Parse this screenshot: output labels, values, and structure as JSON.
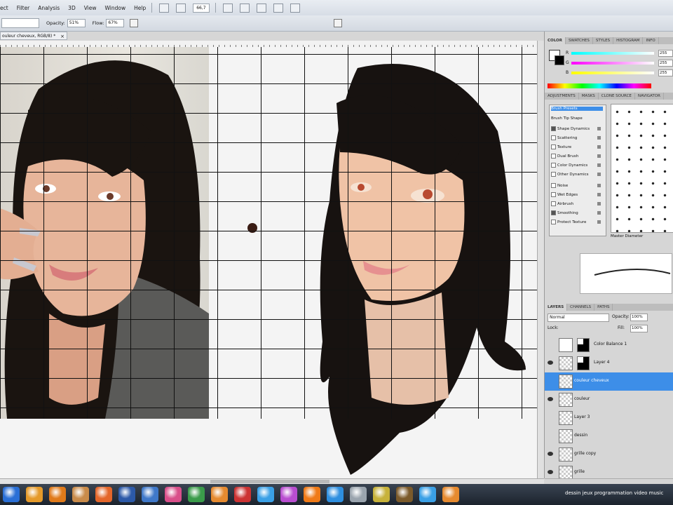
{
  "menubar": {
    "items": [
      "ect",
      "Filter",
      "Analysis",
      "3D",
      "View",
      "Window",
      "Help"
    ],
    "zoom": "66,7"
  },
  "options": {
    "opacity_label": "Opacity:",
    "opacity_value": "51%",
    "flow_label": "Flow:",
    "flow_value": "67%"
  },
  "document": {
    "tab_title": "ouleur cheveux, RGB/8) *",
    "close": "×"
  },
  "color_panel": {
    "tabs": [
      "COLOR",
      "SWATCHES",
      "STYLES",
      "HISTOGRAM",
      "INFO"
    ],
    "channels": [
      {
        "label": "R",
        "value": "255"
      },
      {
        "label": "G",
        "value": "255"
      },
      {
        "label": "B",
        "value": "255"
      }
    ]
  },
  "brush_panel": {
    "tabs": [
      "ADJUSTMENTS",
      "MASKS",
      "CLONE SOURCE",
      "NAVIGATOR"
    ],
    "items": [
      {
        "label": "Brush Presets",
        "checkbox": false,
        "selected": true
      },
      {
        "label": "Brush Tip Shape",
        "checkbox": false,
        "selected": false
      },
      {
        "label": "Shape Dynamics",
        "checkbox": true,
        "checked": true
      },
      {
        "label": "Scattering",
        "checkbox": true,
        "checked": false
      },
      {
        "label": "Texture",
        "checkbox": true,
        "checked": false
      },
      {
        "label": "Dual Brush",
        "checkbox": true,
        "checked": false
      },
      {
        "label": "Color Dynamics",
        "checkbox": true,
        "checked": false
      },
      {
        "label": "Other Dynamics",
        "checkbox": true,
        "checked": false
      },
      {
        "label": "Noise",
        "checkbox": true,
        "checked": false
      },
      {
        "label": "Wet Edges",
        "checkbox": true,
        "checked": false
      },
      {
        "label": "Airbrush",
        "checkbox": true,
        "checked": false
      },
      {
        "label": "Smoothing",
        "checkbox": true,
        "checked": true
      },
      {
        "label": "Protect Texture",
        "checkbox": true,
        "checked": false
      }
    ],
    "master_diameter_label": "Master Diameter"
  },
  "layers_panel": {
    "tabs": [
      "LAYERS",
      "CHANNELS",
      "PATHS"
    ],
    "blend_mode": "Normal",
    "opacity_label": "Opacity:",
    "opacity_value": "100%",
    "lock_label": "Lock:",
    "fill_label": "Fill:",
    "fill_value": "100%",
    "layers": [
      {
        "name": "Color Balance 1",
        "visible": false,
        "adjustment": true,
        "selected": false
      },
      {
        "name": "Layer 4",
        "visible": true,
        "mask": true,
        "selected": false
      },
      {
        "name": "couleur cheveux",
        "visible": false,
        "selected": true
      },
      {
        "name": "couleur",
        "visible": true,
        "selected": false
      },
      {
        "name": "Layer 3",
        "visible": false,
        "selected": false
      },
      {
        "name": "dessin",
        "visible": false,
        "selected": false
      },
      {
        "name": "grille copy",
        "visible": true,
        "selected": false
      },
      {
        "name": "grille",
        "visible": true,
        "selected": false
      }
    ]
  },
  "taskbar": {
    "text": "dessin  jeux  programmation video music",
    "app_colors": [
      "#2a6fd6",
      "#e59a2a",
      "#e07a1a",
      "#c98b4a",
      "#e4662a",
      "#2c59a8",
      "#3f78c9",
      "#d94f8a",
      "#3a9b4a",
      "#e68a2f",
      "#cc3333",
      "#3aa0e6",
      "#b94dd0",
      "#f07a17",
      "#2e8fe0",
      "#9aa4ae",
      "#c7b23a",
      "#7b5a2a",
      "#3aa0e6",
      "#e68a2f"
    ]
  }
}
